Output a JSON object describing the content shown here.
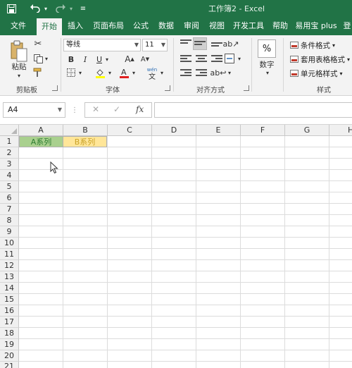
{
  "window": {
    "title": "工作簿2  -  Excel"
  },
  "tabs": [
    {
      "label": "文件"
    },
    {
      "label": "开始"
    },
    {
      "label": "插入"
    },
    {
      "label": "页面布局"
    },
    {
      "label": "公式"
    },
    {
      "label": "数据"
    },
    {
      "label": "审阅"
    },
    {
      "label": "视图"
    },
    {
      "label": "开发工具"
    },
    {
      "label": "帮助"
    },
    {
      "label": "易用宝 plus"
    },
    {
      "label": "登"
    }
  ],
  "ribbon": {
    "clipboard": {
      "paste_label": "粘贴",
      "group_label": "剪贴板"
    },
    "font": {
      "font_name": "等线",
      "font_size": "11",
      "group_label": "字体",
      "wen_label": "wén"
    },
    "alignment": {
      "group_label": "对齐方式"
    },
    "number": {
      "button_label": "数字",
      "percent": "%",
      "group_label": ""
    },
    "styles": {
      "conditional": "条件格式",
      "table": "套用表格格式",
      "cell": "单元格样式",
      "group_label": "样式"
    }
  },
  "formula_bar": {
    "name_box": "A4",
    "fx_label": "fx",
    "formula": ""
  },
  "grid": {
    "columns": [
      "A",
      "B",
      "C",
      "D",
      "E",
      "F",
      "G",
      "H"
    ],
    "rows": [
      "1",
      "2",
      "3",
      "4",
      "5",
      "6",
      "7",
      "8",
      "9",
      "10",
      "11",
      "12",
      "13",
      "14",
      "15",
      "16",
      "17",
      "18",
      "19",
      "20",
      "21"
    ],
    "cells": {
      "A1": "A系列",
      "B1": "B系列"
    },
    "cell_colors": {
      "A1_bg": "#a9d08e",
      "A1_fg": "#2e7d32",
      "B1_bg": "#ffe699",
      "B1_fg": "#c9a227"
    }
  },
  "colors": {
    "accent": "#217346"
  }
}
